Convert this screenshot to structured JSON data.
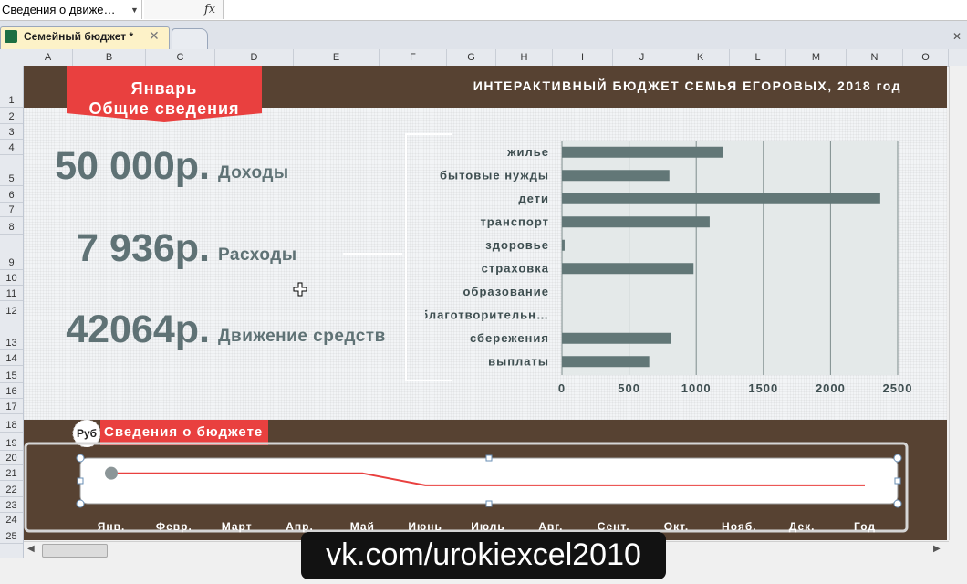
{
  "formula_bar": {
    "name_box": "Сведения о движе…",
    "fx": "fx"
  },
  "tabs": [
    {
      "label": "Семейный бюджет *",
      "close": "✕"
    }
  ],
  "window_close": "✕",
  "columns": [
    "A",
    "B",
    "C",
    "D",
    "E",
    "F",
    "G",
    "H",
    "I",
    "J",
    "K",
    "L",
    "M",
    "N",
    "O"
  ],
  "rows": [
    "1",
    "2",
    "3",
    "4",
    "5",
    "6",
    "7",
    "8",
    "9",
    "10",
    "11",
    "12",
    "13",
    "14",
    "15",
    "16",
    "17",
    "18",
    "19",
    "20",
    "21",
    "22",
    "23",
    "24",
    "25"
  ],
  "dashboard": {
    "banner_line1": "Январь",
    "banner_line2": "Общие сведения",
    "title": "ИНТЕРАКТИВНЫЙ БЮДЖЕТ СЕМЬЯ ЕГОРОВЫХ, 2018 год",
    "kpis": [
      {
        "value": "50 000р.",
        "label": "Доходы"
      },
      {
        "value": "7 936р.",
        "label": "Расходы"
      },
      {
        "value": "42064р.",
        "label": "Движение средств"
      }
    ],
    "section_icon": "Руб",
    "section_title": "Сведения о бюджете"
  },
  "colors": {
    "accent_red": "#e9403f",
    "brown": "#574232",
    "bar": "#627777",
    "kpi_text": "#5f7275"
  },
  "chart_data": [
    {
      "type": "bar",
      "orientation": "horizontal",
      "categories": [
        "жилье",
        "бытовые нужды",
        "дети",
        "транспорт",
        "здоровье",
        "страховка",
        "образование",
        "благотворительн…",
        "сбережения",
        "выплаты"
      ],
      "values": [
        1200,
        800,
        2370,
        1100,
        20,
        980,
        0,
        0,
        810,
        650
      ],
      "xlim": [
        0,
        2500
      ],
      "xticks": [
        "0",
        "500",
        "1000",
        "1500",
        "2000",
        "2500"
      ],
      "grid": true
    },
    {
      "type": "line",
      "categories": [
        "Янв.",
        "Февр.",
        "Март",
        "Апр.",
        "Май",
        "Июнь",
        "Июль",
        "Авг.",
        "Сент.",
        "Окт.",
        "Нояб.",
        "Дек.",
        "Год"
      ],
      "values": [
        50000,
        50000,
        50000,
        50000,
        50000,
        42064,
        42064,
        42064,
        42064,
        42064,
        42064,
        42064,
        42064
      ],
      "ylim": [
        30000,
        60000
      ],
      "grid": false
    }
  ],
  "footer": {
    "watermark": "vk.com/urokiexcel2010"
  }
}
